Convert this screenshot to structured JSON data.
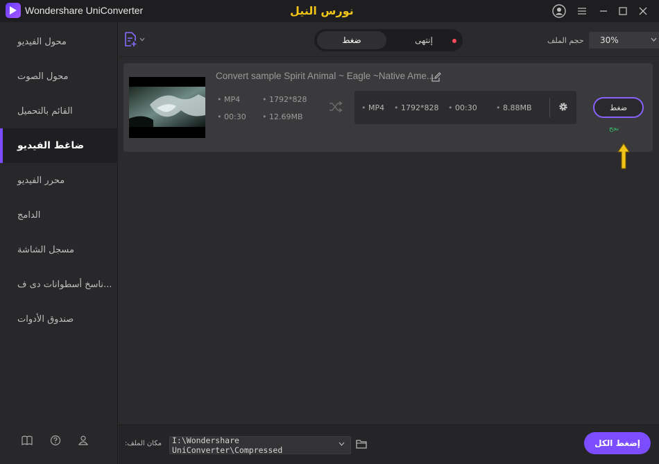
{
  "app": {
    "title": "Wondershare UniConverter",
    "watermark": "نورس النيل"
  },
  "sidebar": {
    "items": [
      {
        "label": "محول الفيديو"
      },
      {
        "label": "محول الصوت"
      },
      {
        "label": "القائم بالتحميل"
      },
      {
        "label": "ضاغط الفيديو",
        "active": true
      },
      {
        "label": "محرر الفيديو"
      },
      {
        "label": "الدامج"
      },
      {
        "label": "مسجل الشاشة"
      },
      {
        "label": "ناسخ أسطوانات دى ف..."
      },
      {
        "label": "صندوق الأدوات"
      }
    ],
    "footer_icons": [
      "book-icon",
      "help-icon",
      "account-icon"
    ]
  },
  "toolbar": {
    "tab_compress": "ضغط",
    "tab_finished": "إنتهى",
    "size_label": "حجم الملف",
    "size_value": "30%"
  },
  "file": {
    "title": "Convert sample Spirit Animal ~ Eagle ~Native Ame...",
    "source": {
      "format": "MP4",
      "resolution": "1792*828",
      "duration": "00:30",
      "size": "12.69MB"
    },
    "target": {
      "format": "MP4",
      "resolution": "1792*828",
      "duration": "00:30",
      "size": "8.88MB"
    },
    "compress_label": "ضغط",
    "status": "نجح"
  },
  "bottom": {
    "location_label": ":مكان الملف",
    "path": "I:\\Wondershare UniConverter\\Compressed",
    "compress_all_label": "إضغط الكل"
  },
  "colors": {
    "accent": "#7b4dff",
    "success": "#37c871",
    "annotation": "#f0c419"
  }
}
